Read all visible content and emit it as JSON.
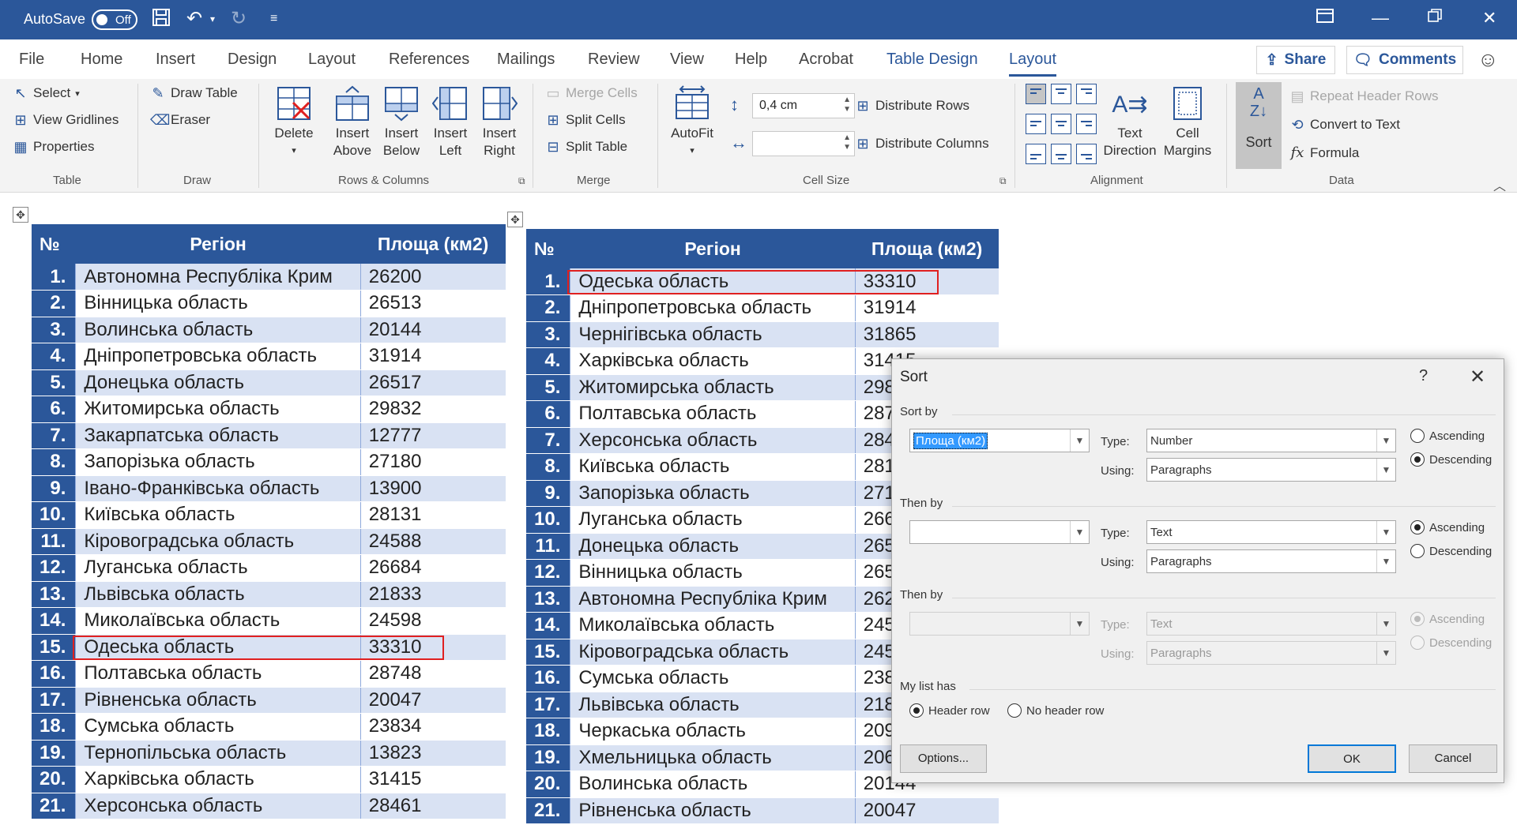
{
  "titlebar": {
    "autosave_label": "AutoSave",
    "toggle_state": "Off",
    "icons": [
      "save-icon",
      "undo-icon",
      "redo-icon",
      "customize-icon",
      "ribbon-display-icon",
      "minimize-icon",
      "restore-icon",
      "close-icon"
    ]
  },
  "tabs": [
    "File",
    "Home",
    "Insert",
    "Design",
    "Layout",
    "References",
    "Mailings",
    "Review",
    "View",
    "Help",
    "Acrobat",
    "Table Design",
    "Layout"
  ],
  "share_label": "Share",
  "comments_label": "Comments",
  "ribbon": {
    "table": {
      "select": "Select",
      "view_gridlines": "View Gridlines",
      "properties": "Properties",
      "group": "Table"
    },
    "draw": {
      "draw_table": "Draw Table",
      "eraser": "Eraser",
      "group": "Draw"
    },
    "rows_cols": {
      "delete": "Delete",
      "insert_above_1": "Insert",
      "insert_above_2": "Above",
      "insert_below_1": "Insert",
      "insert_below_2": "Below",
      "insert_left_1": "Insert",
      "insert_left_2": "Left",
      "insert_right_1": "Insert",
      "insert_right_2": "Right",
      "group": "Rows & Columns"
    },
    "merge": {
      "merge_cells": "Merge Cells",
      "split_cells": "Split Cells",
      "split_table": "Split Table",
      "group": "Merge"
    },
    "cell_size": {
      "autofit": "AutoFit",
      "height_value": "0,4 cm",
      "width_value": "",
      "distribute_rows": "Distribute Rows",
      "distribute_columns": "Distribute Columns",
      "group": "Cell Size"
    },
    "alignment": {
      "text_direction_1": "Text",
      "text_direction_2": "Direction",
      "cell_margins_1": "Cell",
      "cell_margins_2": "Margins",
      "group": "Alignment"
    },
    "data": {
      "sort": "Sort",
      "repeat_header_rows": "Repeat Header Rows",
      "convert_to_text": "Convert to Text",
      "formula": "Formula",
      "group": "Data"
    }
  },
  "table_headers": {
    "num": "№",
    "region": "Регіон",
    "area": "Площа (км2)"
  },
  "left_table": [
    {
      "n": "1.",
      "region": "Автономна Республіка Крим",
      "area": "26200"
    },
    {
      "n": "2.",
      "region": "Вінницька область",
      "area": "26513"
    },
    {
      "n": "3.",
      "region": "Волинська область",
      "area": "20144"
    },
    {
      "n": "4.",
      "region": "Дніпропетровська область",
      "area": "31914"
    },
    {
      "n": "5.",
      "region": "Донецька область",
      "area": "26517"
    },
    {
      "n": "6.",
      "region": "Житомирська область",
      "area": "29832"
    },
    {
      "n": "7.",
      "region": "Закарпатська область",
      "area": "12777"
    },
    {
      "n": "8.",
      "region": "Запорізька область",
      "area": "27180"
    },
    {
      "n": "9.",
      "region": "Івано-Франківська область",
      "area": "13900"
    },
    {
      "n": "10.",
      "region": "Київська область",
      "area": "28131"
    },
    {
      "n": "11.",
      "region": "Кіровоградська область",
      "area": "24588"
    },
    {
      "n": "12.",
      "region": "Луганська область",
      "area": "26684"
    },
    {
      "n": "13.",
      "region": "Львівська область",
      "area": "21833"
    },
    {
      "n": "14.",
      "region": "Миколаївська область",
      "area": "24598"
    },
    {
      "n": "15.",
      "region": "Одеська область",
      "area": "33310"
    },
    {
      "n": "16.",
      "region": "Полтавська область",
      "area": "28748"
    },
    {
      "n": "17.",
      "region": "Рівненська область",
      "area": "20047"
    },
    {
      "n": "18.",
      "region": "Сумська область",
      "area": "23834"
    },
    {
      "n": "19.",
      "region": "Тернопільська область",
      "area": "13823"
    },
    {
      "n": "20.",
      "region": "Харківська область",
      "area": "31415"
    },
    {
      "n": "21.",
      "region": "Херсонська область",
      "area": "28461"
    }
  ],
  "right_table": [
    {
      "n": "1.",
      "region": "Одеська область",
      "area": "33310"
    },
    {
      "n": "2.",
      "region": "Дніпропетровська область",
      "area": "31914"
    },
    {
      "n": "3.",
      "region": "Чернігівська область",
      "area": "31865"
    },
    {
      "n": "4.",
      "region": "Харківська область",
      "area": "31415"
    },
    {
      "n": "5.",
      "region": "Житомирська область",
      "area": "298"
    },
    {
      "n": "6.",
      "region": "Полтавська область",
      "area": "287"
    },
    {
      "n": "7.",
      "region": "Херсонська область",
      "area": "284"
    },
    {
      "n": "8.",
      "region": "Київська область",
      "area": "281"
    },
    {
      "n": "9.",
      "region": "Запорізька область",
      "area": "271"
    },
    {
      "n": "10.",
      "region": "Луганська область",
      "area": "266"
    },
    {
      "n": "11.",
      "region": "Донецька область",
      "area": "265"
    },
    {
      "n": "12.",
      "region": "Вінницька область",
      "area": "265"
    },
    {
      "n": "13.",
      "region": "Автономна Республіка Крим",
      "area": "262"
    },
    {
      "n": "14.",
      "region": "Миколаївська область",
      "area": "245"
    },
    {
      "n": "15.",
      "region": "Кіровоградська область",
      "area": "245"
    },
    {
      "n": "16.",
      "region": "Сумська область",
      "area": "238"
    },
    {
      "n": "17.",
      "region": "Львівська область",
      "area": "218"
    },
    {
      "n": "18.",
      "region": "Черкаська область",
      "area": "209"
    },
    {
      "n": "19.",
      "region": "Хмельницька область",
      "area": "206"
    },
    {
      "n": "20.",
      "region": "Волинська область",
      "area": "20144"
    },
    {
      "n": "21.",
      "region": "Рівненська область",
      "area": "20047"
    }
  ],
  "dialog": {
    "title": "Sort",
    "help": "?",
    "sort_by_label": "Sort by",
    "sort_by_value": "Площа (км2)",
    "type_label": "Type:",
    "using_label": "Using:",
    "sort_by_type": "Number",
    "sort_by_using": "Paragraphs",
    "then_by_label": "Then by",
    "then1_value": "",
    "then1_type": "Text",
    "then1_using": "Paragraphs",
    "then2_value": "",
    "then2_type": "Text",
    "then2_using": "Paragraphs",
    "ascending": "Ascending",
    "descending": "Descending",
    "list_has_label": "My list has",
    "header_row": "Header row",
    "no_header_row": "No header row",
    "options": "Options...",
    "ok": "OK",
    "cancel": "Cancel"
  }
}
